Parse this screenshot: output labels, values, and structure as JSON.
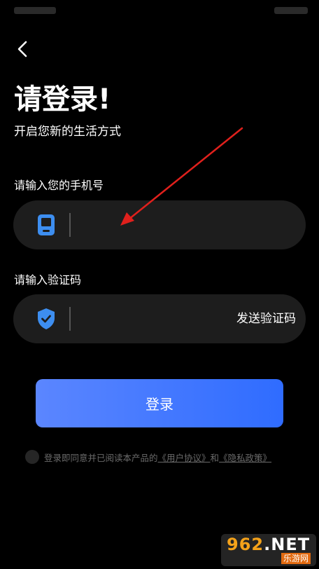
{
  "header": {
    "back_icon": "chevron-left-icon",
    "title": "请登录!",
    "subtitle": "开启您新的生活方式"
  },
  "phone": {
    "label": "请输入您的手机号",
    "value": "",
    "icon": "phone-icon"
  },
  "code": {
    "label": "请输入验证码",
    "value": "",
    "icon": "shield-check-icon",
    "send_label": "发送验证码"
  },
  "login": {
    "label": "登录"
  },
  "agreement": {
    "checked": false,
    "prefix": "登录即同意并已阅读本产品的",
    "user_agreement": "《用户协议》",
    "and": "和",
    "privacy_policy": "《隐私政策》"
  },
  "watermark": {
    "main_accent": "962",
    "main_rest": ".NET",
    "sub": "乐游网"
  },
  "colors": {
    "background": "#000000",
    "field_bg": "#1d1d1d",
    "button_gradient_start": "#5b86ff",
    "button_gradient_end": "#2f6cff",
    "annotation_arrow": "#e0201c",
    "icon_blue": "#3d8ef0"
  }
}
